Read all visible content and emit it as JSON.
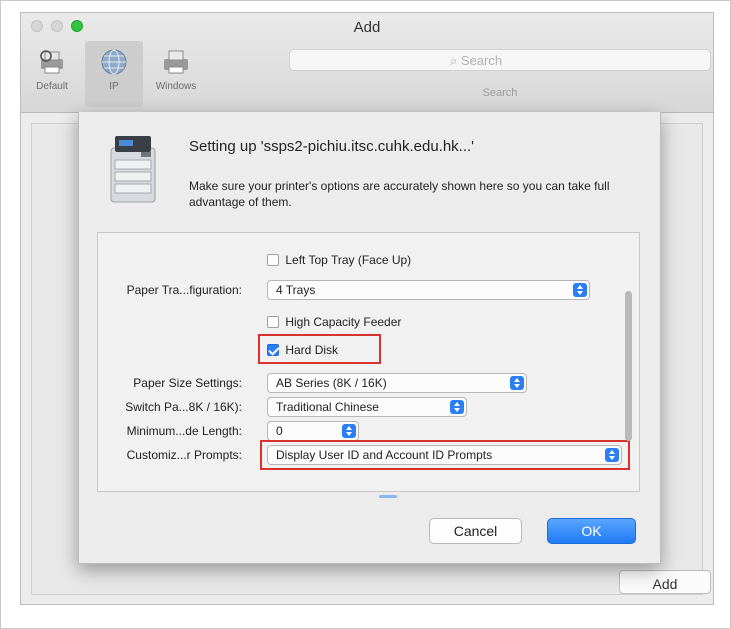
{
  "window": {
    "title": "Add"
  },
  "toolbar": {
    "items": [
      {
        "label": "Default",
        "icon": "default-printer-icon"
      },
      {
        "label": "IP",
        "icon": "ip-globe-icon",
        "selected": true
      },
      {
        "label": "Windows",
        "icon": "windows-printer-icon"
      }
    ],
    "search_placeholder": "Search",
    "search_label": "Search"
  },
  "sheet": {
    "title": "Setting up 'ssps2-pichiu.itsc.cuhk.edu.hk...'",
    "description": "Make sure your printer's options are accurately shown here so you can take full advantage of them.",
    "options": {
      "left_top_tray": {
        "label": "Left Top Tray (Face Up)",
        "checked": false
      },
      "paper_tray_config": {
        "label": "Paper Tra...figuration:",
        "value": "4 Trays"
      },
      "high_capacity_feeder": {
        "label": "High Capacity Feeder",
        "checked": false
      },
      "hard_disk": {
        "label": "Hard Disk",
        "checked": true
      },
      "paper_size_settings": {
        "label": "Paper Size Settings:",
        "value": "AB Series (8K / 16K)"
      },
      "switch_paper": {
        "label": "Switch Pa...8K / 16K):",
        "value": "Traditional Chinese"
      },
      "minimum_length": {
        "label": "Minimum...de Length:",
        "value": "0"
      },
      "customize_prompts": {
        "label": "Customiz...r Prompts:",
        "value": "Display User ID and Account ID Prompts"
      }
    },
    "cancel_label": "Cancel",
    "ok_label": "OK"
  },
  "behind": {
    "add_label": "Add"
  },
  "colors": {
    "accent": "#2b7ff5",
    "highlight": "#d9312f"
  }
}
